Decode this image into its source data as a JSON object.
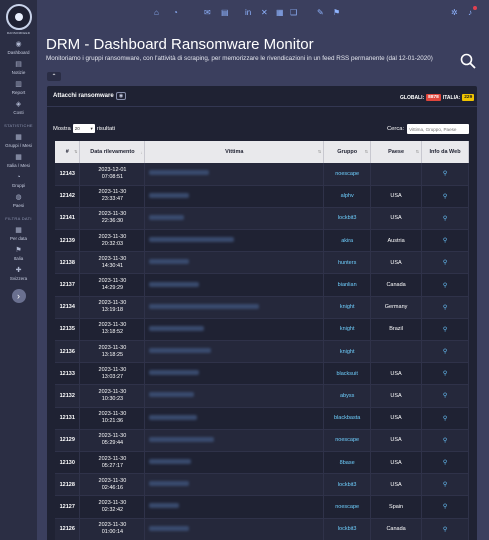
{
  "sidebar": {
    "logo_text": "RANSOMFEED",
    "items": [
      {
        "label": "Dashboard",
        "icon": "dashboard-icon",
        "glyph": "◉"
      },
      {
        "label": "Notizie",
        "icon": "news-icon",
        "glyph": "▤"
      },
      {
        "label": "Report",
        "icon": "report-icon",
        "glyph": "▥"
      },
      {
        "label": "Costi",
        "icon": "costs-icon",
        "glyph": "◈"
      }
    ],
    "section_stats": "STATISTICHE",
    "stats_items": [
      {
        "label": "Gruppi / Mesi",
        "icon": "groups-months-icon",
        "glyph": "▦"
      },
      {
        "label": "Italia / Mesi",
        "icon": "italy-months-icon",
        "glyph": "▦"
      },
      {
        "label": "Gruppi",
        "icon": "groups-icon",
        "glyph": "◔"
      },
      {
        "label": "Paesi",
        "icon": "countries-icon",
        "glyph": "◍"
      }
    ],
    "section_filter": "FILTRA DATI",
    "filter_items": [
      {
        "label": "Per data",
        "icon": "calendar-icon",
        "glyph": "▦"
      },
      {
        "label": "Italia",
        "icon": "italy-icon",
        "glyph": "⚑"
      },
      {
        "label": "Svizzera",
        "icon": "switzerland-icon",
        "glyph": "✚"
      }
    ]
  },
  "header": {
    "title": "DRM - Dashboard Ransomware Monitor",
    "subtitle": "Monitoriamo i gruppi ransomware, con l'attività di scraping, per memorizzare le rivendicazioni in un feed RSS permanente (dal 12-01-2020)"
  },
  "panel": {
    "title": "Attacchi ransomware",
    "globali_label": "GLOBALI:",
    "globali_value": "8878",
    "italia_label": "ITALIA:",
    "italia_value": "229",
    "show_label": "Mostra",
    "show_value": "20",
    "results_label": "risultati",
    "search_label": "Cerca:",
    "search_placeholder": "Vittima, Gruppo, Paese"
  },
  "table": {
    "headers": [
      "#",
      "Data rilevamento",
      "Vittima",
      "Gruppo",
      "Paese",
      "Info da Web"
    ],
    "rows": [
      {
        "id": "12143",
        "date": "2023-12-01",
        "time": "07:08:51",
        "group": "noescape",
        "country": "",
        "w": 60
      },
      {
        "id": "12142",
        "date": "2023-11-30",
        "time": "23:33:47",
        "group": "alphv",
        "country": "USA",
        "w": 40
      },
      {
        "id": "12141",
        "date": "2023-11-30",
        "time": "22:36:30",
        "group": "lockbit3",
        "country": "USA",
        "w": 35
      },
      {
        "id": "12139",
        "date": "2023-11-30",
        "time": "20:32:03",
        "group": "akira",
        "country": "Austria",
        "w": 85
      },
      {
        "id": "12138",
        "date": "2023-11-30",
        "time": "14:30:41",
        "group": "hunters",
        "country": "USA",
        "w": 40
      },
      {
        "id": "12137",
        "date": "2023-11-30",
        "time": "14:29:29",
        "group": "bianlian",
        "country": "Canada",
        "w": 50
      },
      {
        "id": "12134",
        "date": "2023-11-30",
        "time": "13:19:18",
        "group": "knight",
        "country": "Germany",
        "w": 110
      },
      {
        "id": "12135",
        "date": "2023-11-30",
        "time": "13:18:52",
        "group": "knight",
        "country": "Brazil",
        "w": 55
      },
      {
        "id": "12136",
        "date": "2023-11-30",
        "time": "13:18:25",
        "group": "knight",
        "country": "",
        "w": 62
      },
      {
        "id": "12133",
        "date": "2023-11-30",
        "time": "13:03:27",
        "group": "blacksuit",
        "country": "USA",
        "w": 50
      },
      {
        "id": "12132",
        "date": "2023-11-30",
        "time": "10:30:23",
        "group": "abyss",
        "country": "USA",
        "w": 45
      },
      {
        "id": "12131",
        "date": "2023-11-30",
        "time": "10:21:36",
        "group": "blackbasta",
        "country": "USA",
        "w": 48
      },
      {
        "id": "12129",
        "date": "2023-11-30",
        "time": "05:29:44",
        "group": "noescape",
        "country": "USA",
        "w": 65
      },
      {
        "id": "12130",
        "date": "2023-11-30",
        "time": "05:27:17",
        "group": "8base",
        "country": "USA",
        "w": 42
      },
      {
        "id": "12128",
        "date": "2023-11-30",
        "time": "02:46:16",
        "group": "lockbit3",
        "country": "USA",
        "w": 40
      },
      {
        "id": "12127",
        "date": "2023-11-30",
        "time": "02:32:42",
        "group": "noescape",
        "country": "Spain",
        "w": 30
      },
      {
        "id": "12126",
        "date": "2023-11-30",
        "time": "01:00:14",
        "group": "lockbit3",
        "country": "Canada",
        "w": 40
      }
    ]
  },
  "colors": {
    "background": "#3b3f5e",
    "sidebar": "#2b2e44",
    "panel": "#1f2233",
    "link": "#6fd0ff",
    "badge_red": "#e0463c",
    "badge_yellow": "#f0c400"
  }
}
